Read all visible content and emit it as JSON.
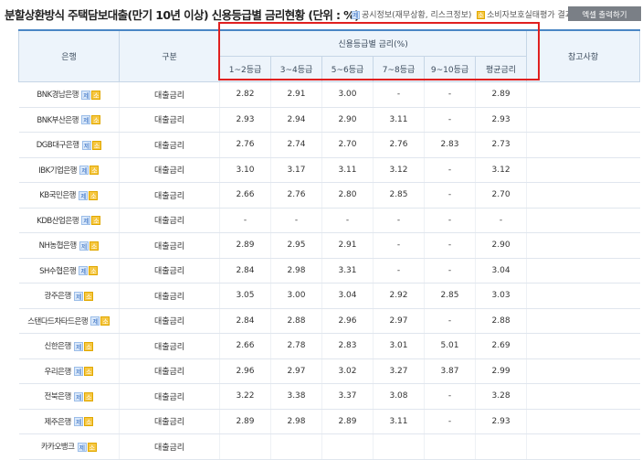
{
  "header": {
    "title": "분할상환방식 주택담보대출(만기 10년 이상) 신용등급별 금리현황 (단위 : %)",
    "legend_disclosure": "공시정보(재무상황, 리스크정보)",
    "legend_disclosure_icon": "제",
    "legend_consumer": "소비자보호실태평가 결과",
    "legend_consumer_icon": "소",
    "excel_button": "엑셀 출력하기"
  },
  "table": {
    "col_bank": "은행",
    "col_type": "구분",
    "group_header": "신용등급별 금리(%)",
    "grades": [
      "1~2등급",
      "3~4등급",
      "5~6등급",
      "7~8등급",
      "9~10등급",
      "평균금리"
    ],
    "col_note": "참고사항",
    "rows": [
      {
        "bank": "BNK경남은행",
        "type": "대출금리",
        "v": [
          "2.82",
          "2.91",
          "3.00",
          "-",
          "-",
          "2.89"
        ]
      },
      {
        "bank": "BNK부산은행",
        "type": "대출금리",
        "v": [
          "2.93",
          "2.94",
          "2.90",
          "3.11",
          "-",
          "2.93"
        ]
      },
      {
        "bank": "DGB대구은행",
        "type": "대출금리",
        "v": [
          "2.76",
          "2.74",
          "2.70",
          "2.76",
          "2.83",
          "2.73"
        ]
      },
      {
        "bank": "IBK기업은행",
        "type": "대출금리",
        "v": [
          "3.10",
          "3.17",
          "3.11",
          "3.12",
          "-",
          "3.12"
        ]
      },
      {
        "bank": "KB국민은행",
        "type": "대출금리",
        "v": [
          "2.66",
          "2.76",
          "2.80",
          "2.85",
          "-",
          "2.70"
        ]
      },
      {
        "bank": "KDB산업은행",
        "type": "대출금리",
        "v": [
          "-",
          "-",
          "-",
          "-",
          "-",
          "-"
        ]
      },
      {
        "bank": "NH농협은행",
        "type": "대출금리",
        "v": [
          "2.89",
          "2.95",
          "2.91",
          "-",
          "-",
          "2.90"
        ]
      },
      {
        "bank": "SH수협은행",
        "type": "대출금리",
        "v": [
          "2.84",
          "2.98",
          "3.31",
          "-",
          "-",
          "3.04"
        ]
      },
      {
        "bank": "광주은행",
        "type": "대출금리",
        "v": [
          "3.05",
          "3.00",
          "3.04",
          "2.92",
          "2.85",
          "3.03"
        ]
      },
      {
        "bank": "스탠다드차타드은행",
        "type": "대출금리",
        "v": [
          "2.84",
          "2.88",
          "2.96",
          "2.97",
          "-",
          "2.88"
        ]
      },
      {
        "bank": "신한은행",
        "type": "대출금리",
        "v": [
          "2.66",
          "2.78",
          "2.83",
          "3.01",
          "5.01",
          "2.69"
        ]
      },
      {
        "bank": "우리은행",
        "type": "대출금리",
        "v": [
          "2.96",
          "2.97",
          "3.02",
          "3.27",
          "3.87",
          "2.99"
        ]
      },
      {
        "bank": "전북은행",
        "type": "대출금리",
        "v": [
          "3.22",
          "3.38",
          "3.37",
          "3.08",
          "-",
          "3.28"
        ]
      },
      {
        "bank": "제주은행",
        "type": "대출금리",
        "v": [
          "2.89",
          "2.98",
          "2.89",
          "3.11",
          "-",
          "2.93"
        ]
      },
      {
        "bank": "카카오뱅크",
        "type": "대출금리",
        "v": [
          "",
          "",
          "",
          "",
          "",
          ""
        ]
      }
    ]
  },
  "colors": {
    "highlight": "#e02020",
    "header_bg": "#edf4fb",
    "excel_button": "#7a7f86"
  }
}
